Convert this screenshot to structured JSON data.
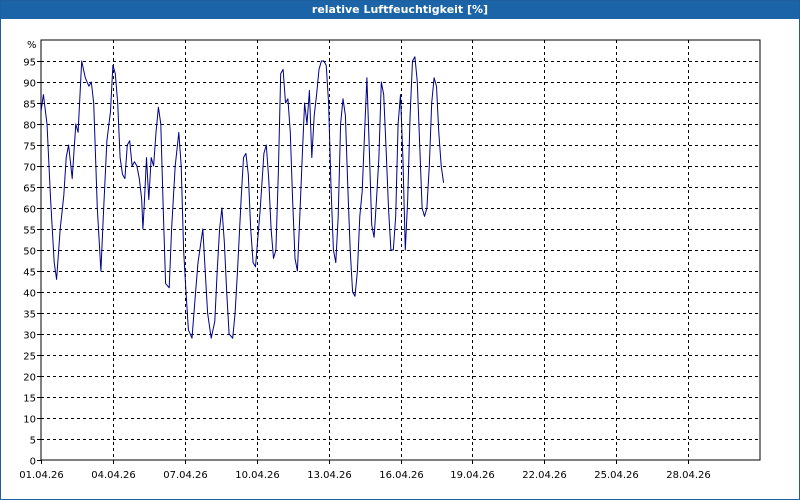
{
  "window": {
    "title": "relative Luftfeuchtigkeit [%]"
  },
  "chart_data": {
    "type": "line",
    "title": "relative Luftfeuchtigkeit [%]",
    "ylabel": "%",
    "xlabel": "",
    "ylim": [
      0,
      100
    ],
    "yticks": [
      0,
      5,
      10,
      15,
      20,
      25,
      30,
      35,
      40,
      45,
      50,
      55,
      60,
      65,
      70,
      75,
      80,
      85,
      90,
      95
    ],
    "xlim": [
      0,
      30
    ],
    "xticks": [
      {
        "x": 0,
        "label": "01.04.26"
      },
      {
        "x": 3,
        "label": "04.04.26"
      },
      {
        "x": 6,
        "label": "07.04.26"
      },
      {
        "x": 9,
        "label": "10.04.26"
      },
      {
        "x": 12,
        "label": "13.04.26"
      },
      {
        "x": 15,
        "label": "16.04.26"
      },
      {
        "x": 18,
        "label": "19.04.26"
      },
      {
        "x": 21,
        "label": "22.04.26"
      },
      {
        "x": 24,
        "label": "25.04.26"
      },
      {
        "x": 27,
        "label": "28.04.26"
      }
    ],
    "grid": true,
    "series": [
      {
        "color": "#00008b",
        "points": [
          [
            0.0,
            83
          ],
          [
            0.1,
            87
          ],
          [
            0.25,
            80
          ],
          [
            0.4,
            62
          ],
          [
            0.55,
            47
          ],
          [
            0.65,
            43
          ],
          [
            0.8,
            55
          ],
          [
            0.95,
            63
          ],
          [
            1.05,
            72
          ],
          [
            1.15,
            75
          ],
          [
            1.3,
            67
          ],
          [
            1.45,
            80
          ],
          [
            1.55,
            78
          ],
          [
            1.7,
            95
          ],
          [
            1.85,
            91
          ],
          [
            2.0,
            89
          ],
          [
            2.1,
            90
          ],
          [
            2.2,
            85
          ],
          [
            2.35,
            60
          ],
          [
            2.5,
            45
          ],
          [
            2.6,
            58
          ],
          [
            2.75,
            76
          ],
          [
            2.9,
            83
          ],
          [
            3.0,
            94
          ],
          [
            3.1,
            92
          ],
          [
            3.2,
            85
          ],
          [
            3.3,
            72
          ],
          [
            3.4,
            68
          ],
          [
            3.5,
            67
          ],
          [
            3.6,
            75
          ],
          [
            3.7,
            76
          ],
          [
            3.8,
            70
          ],
          [
            3.9,
            71
          ],
          [
            4.0,
            70
          ],
          [
            4.1,
            67
          ],
          [
            4.2,
            62
          ],
          [
            4.25,
            55
          ],
          [
            4.3,
            60
          ],
          [
            4.4,
            72
          ],
          [
            4.5,
            62
          ],
          [
            4.6,
            72
          ],
          [
            4.7,
            70
          ],
          [
            4.8,
            78
          ],
          [
            4.9,
            84
          ],
          [
            5.0,
            80
          ],
          [
            5.1,
            60
          ],
          [
            5.2,
            42
          ],
          [
            5.35,
            41
          ],
          [
            5.45,
            55
          ],
          [
            5.6,
            70
          ],
          [
            5.75,
            78
          ],
          [
            5.85,
            70
          ],
          [
            5.95,
            50
          ],
          [
            6.05,
            40
          ],
          [
            6.15,
            31
          ],
          [
            6.3,
            29
          ],
          [
            6.45,
            40
          ],
          [
            6.55,
            47
          ],
          [
            6.65,
            51
          ],
          [
            6.75,
            55
          ],
          [
            6.85,
            45
          ],
          [
            6.95,
            35
          ],
          [
            7.1,
            29
          ],
          [
            7.25,
            33
          ],
          [
            7.35,
            45
          ],
          [
            7.45,
            55
          ],
          [
            7.55,
            60
          ],
          [
            7.65,
            52
          ],
          [
            7.75,
            40
          ],
          [
            7.85,
            30
          ],
          [
            8.0,
            29
          ],
          [
            8.1,
            35
          ],
          [
            8.2,
            45
          ],
          [
            8.35,
            62
          ],
          [
            8.45,
            72
          ],
          [
            8.55,
            73
          ],
          [
            8.65,
            68
          ],
          [
            8.75,
            55
          ],
          [
            8.85,
            47
          ],
          [
            8.95,
            46
          ],
          [
            9.05,
            53
          ],
          [
            9.15,
            60
          ],
          [
            9.3,
            73
          ],
          [
            9.4,
            75
          ],
          [
            9.5,
            67
          ],
          [
            9.6,
            55
          ],
          [
            9.7,
            48
          ],
          [
            9.8,
            50
          ],
          [
            9.9,
            68
          ],
          [
            10.0,
            92
          ],
          [
            10.1,
            93
          ],
          [
            10.2,
            85
          ],
          [
            10.3,
            86
          ],
          [
            10.4,
            78
          ],
          [
            10.5,
            62
          ],
          [
            10.6,
            48
          ],
          [
            10.7,
            45
          ],
          [
            10.8,
            58
          ],
          [
            10.9,
            72
          ],
          [
            11.0,
            85
          ],
          [
            11.1,
            80
          ],
          [
            11.2,
            88
          ],
          [
            11.3,
            72
          ],
          [
            11.4,
            82
          ],
          [
            11.5,
            87
          ],
          [
            11.6,
            93
          ],
          [
            11.7,
            95
          ],
          [
            11.8,
            95
          ],
          [
            11.9,
            94
          ],
          [
            12.0,
            85
          ],
          [
            12.1,
            65
          ],
          [
            12.2,
            50
          ],
          [
            12.3,
            47
          ],
          [
            12.4,
            58
          ],
          [
            12.5,
            80
          ],
          [
            12.6,
            86
          ],
          [
            12.7,
            82
          ],
          [
            12.8,
            65
          ],
          [
            12.9,
            50
          ],
          [
            13.0,
            40
          ],
          [
            13.1,
            39
          ],
          [
            13.2,
            45
          ],
          [
            13.3,
            58
          ],
          [
            13.4,
            64
          ],
          [
            13.5,
            78
          ],
          [
            13.6,
            91
          ],
          [
            13.7,
            74
          ],
          [
            13.8,
            56
          ],
          [
            13.9,
            53
          ],
          [
            14.0,
            62
          ],
          [
            14.1,
            72
          ],
          [
            14.2,
            90
          ],
          [
            14.3,
            87
          ],
          [
            14.4,
            74
          ],
          [
            14.5,
            60
          ],
          [
            14.6,
            50
          ],
          [
            14.7,
            50
          ],
          [
            14.8,
            58
          ],
          [
            14.9,
            80
          ],
          [
            15.0,
            87
          ],
          [
            15.1,
            72
          ],
          [
            15.2,
            50
          ],
          [
            15.3,
            62
          ],
          [
            15.4,
            82
          ],
          [
            15.5,
            95
          ],
          [
            15.6,
            96
          ],
          [
            15.7,
            90
          ],
          [
            15.8,
            75
          ],
          [
            15.9,
            60
          ],
          [
            16.0,
            58
          ],
          [
            16.1,
            60
          ],
          [
            16.2,
            70
          ],
          [
            16.3,
            85
          ],
          [
            16.4,
            91
          ],
          [
            16.5,
            89
          ],
          [
            16.6,
            78
          ],
          [
            16.7,
            70
          ],
          [
            16.8,
            66
          ]
        ]
      }
    ]
  }
}
